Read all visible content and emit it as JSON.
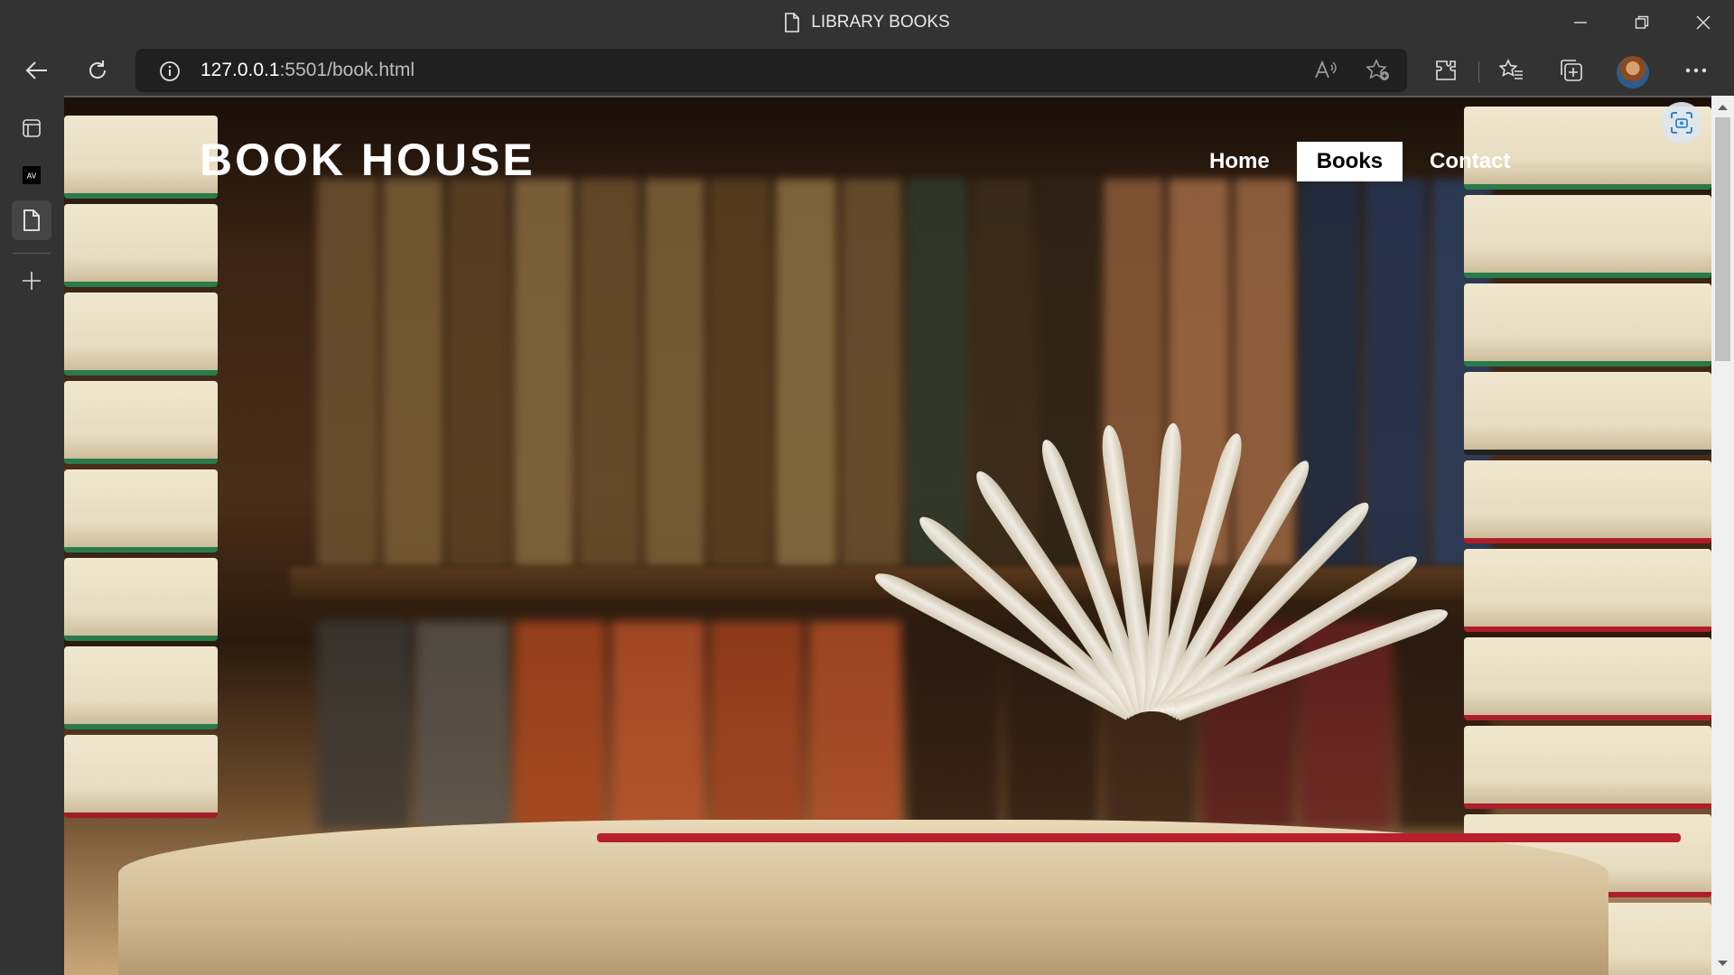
{
  "window": {
    "title": "LIBRARY BOOKS",
    "controls": [
      "minimize-icon",
      "restore-icon",
      "close-icon"
    ]
  },
  "toolbar": {
    "url_host": "127.0.0.1",
    "url_rest": ":5501/book.html",
    "icons": [
      "back-icon",
      "refresh-icon",
      "site-info-icon",
      "read-aloud-icon",
      "add-favorite-icon",
      "extensions-icon",
      "favorites-icon",
      "collections-icon",
      "profile-avatar",
      "more-icon"
    ]
  },
  "sidebar": {
    "items": [
      "tab-actions-icon",
      "app-tab-icon",
      "page-tab-icon",
      "new-tab-icon"
    ]
  },
  "page": {
    "brand": "BOOK HOUSE",
    "nav": [
      {
        "label": "Home",
        "active": false
      },
      {
        "label": "Books",
        "active": true
      },
      {
        "label": "Contact",
        "active": false
      }
    ],
    "colors": {
      "nav_active_bg": "#ffffff",
      "nav_active_text": "#000000",
      "text": "#ffffff"
    }
  }
}
